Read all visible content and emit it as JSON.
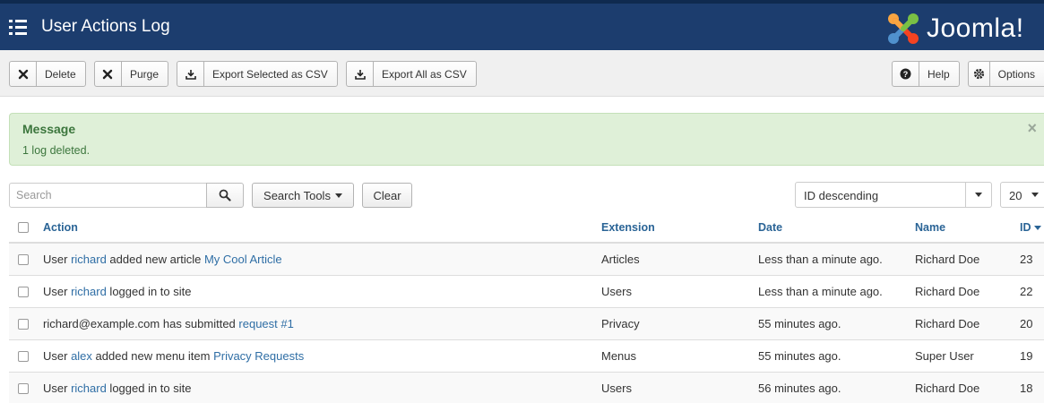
{
  "header": {
    "title": "User Actions Log",
    "logo_text": "Joomla!"
  },
  "toolbar": {
    "delete_label": "Delete",
    "purge_label": "Purge",
    "export_selected_label": "Export Selected as CSV",
    "export_all_label": "Export All as CSV",
    "help_label": "Help",
    "options_label": "Options"
  },
  "message": {
    "title": "Message",
    "text": "1 log deleted.",
    "close": "×"
  },
  "filters": {
    "search_placeholder": "Search",
    "search_tools_label": "Search Tools",
    "clear_label": "Clear",
    "ordering_value": "ID descending",
    "limit_value": "20"
  },
  "table": {
    "headers": {
      "action": "Action",
      "extension": "Extension",
      "date": "Date",
      "name": "Name",
      "id": "ID"
    },
    "rows": [
      {
        "pre": "User ",
        "user": "richard",
        "mid": " added new article ",
        "item": "My Cool Article",
        "extension": "Articles",
        "date": "Less than a minute ago.",
        "name": "Richard Doe",
        "id": "23"
      },
      {
        "pre": "User ",
        "user": "richard",
        "mid": " logged in to site",
        "item": "",
        "extension": "Users",
        "date": "Less than a minute ago.",
        "name": "Richard Doe",
        "id": "22"
      },
      {
        "pre": "richard@example.com has submitted ",
        "user": "",
        "mid": "",
        "item": "request #1",
        "extension": "Privacy",
        "date": "55 minutes ago.",
        "name": "Richard Doe",
        "id": "20"
      },
      {
        "pre": "User ",
        "user": "alex",
        "mid": " added new menu item ",
        "item": "Privacy Requests",
        "extension": "Menus",
        "date": "55 minutes ago.",
        "name": "Super User",
        "id": "19"
      },
      {
        "pre": "User ",
        "user": "richard",
        "mid": " logged in to site",
        "item": "",
        "extension": "Users",
        "date": "56 minutes ago.",
        "name": "Richard Doe",
        "id": "18"
      }
    ]
  },
  "colors": {
    "header_bg": "#1c3d6e",
    "message_bg": "#dff0d8",
    "message_text": "#3c763d",
    "link": "#2f6ea5"
  },
  "icons": [
    "menu-list-icon",
    "joomla-logo-icon",
    "close-x-icon",
    "download-icon",
    "question-icon",
    "gear-icon",
    "search-icon",
    "caret-down-icon"
  ]
}
